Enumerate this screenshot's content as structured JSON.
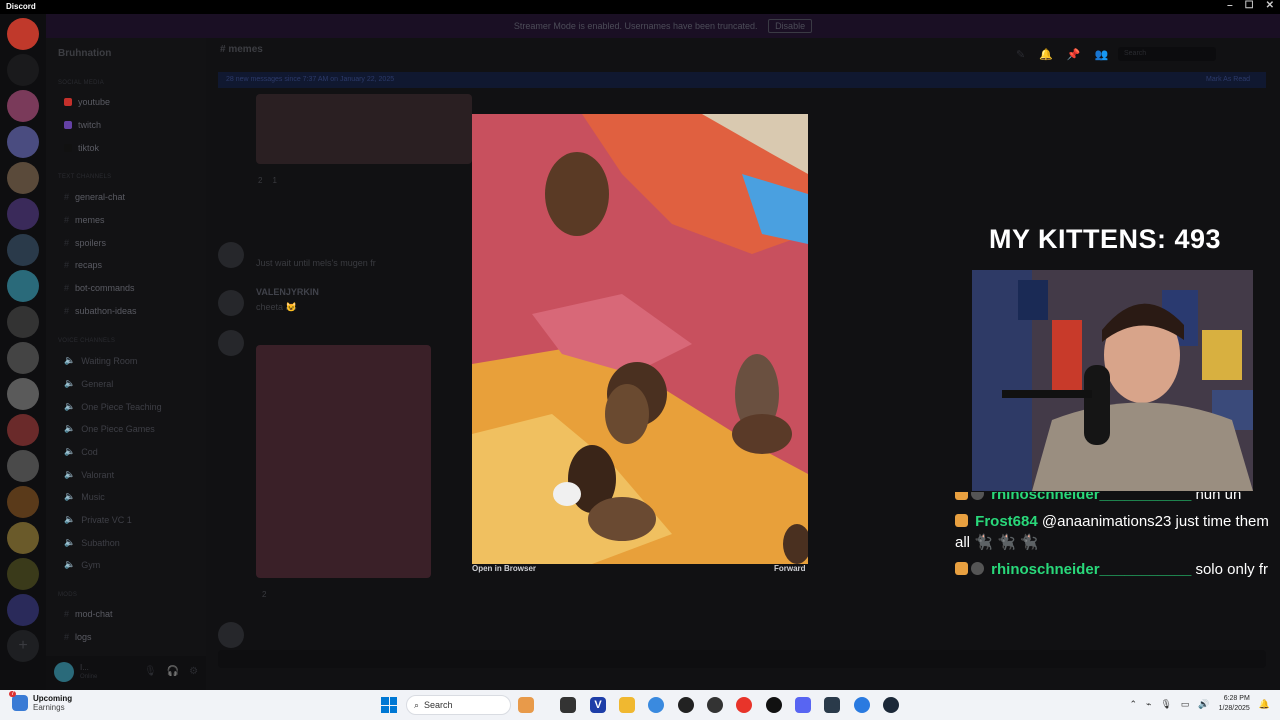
{
  "window": {
    "app_name": "Discord",
    "controls": [
      "–",
      "☐",
      "✕"
    ]
  },
  "streamer_banner": {
    "text": "Streamer Mode is enabled. Usernames have been truncated.",
    "disable_label": "Disable"
  },
  "server": {
    "name": "Bruhnation"
  },
  "sidebar": {
    "sections": [
      {
        "title": "SOCIAL MEDIA",
        "channels": [
          {
            "name": "youtube",
            "color": "#c4302b"
          },
          {
            "name": "twitch",
            "color": "#6441a5"
          },
          {
            "name": "tiktok",
            "color": "#111111"
          }
        ]
      },
      {
        "title": "TEXT CHANNELS",
        "channels": [
          {
            "name": "general-chat"
          },
          {
            "name": "memes"
          },
          {
            "name": "spoilers"
          },
          {
            "name": "recaps"
          },
          {
            "name": "bot-commands"
          },
          {
            "name": "subathon-ideas"
          }
        ]
      },
      {
        "title": "VOICE CHANNELS",
        "channels": [
          {
            "name": "Waiting Room"
          },
          {
            "name": "General"
          },
          {
            "name": "One Piece Teaching"
          },
          {
            "name": "One Piece Games"
          },
          {
            "name": "Cod"
          },
          {
            "name": "Valorant"
          },
          {
            "name": "Music"
          },
          {
            "name": "Private VC 1"
          },
          {
            "name": "Subathon"
          },
          {
            "name": "Gym"
          }
        ]
      },
      {
        "title": "MODS",
        "channels": [
          {
            "name": "mod-chat"
          },
          {
            "name": "logs"
          }
        ]
      }
    ],
    "user": {
      "name": "I...",
      "status": "Online"
    }
  },
  "channel_header": {
    "name": "memes",
    "search_placeholder": "Search"
  },
  "new_messages": {
    "text": "28 new messages since 7:37 AM on January 22, 2025",
    "action": "Mark As Read"
  },
  "messages": [
    {
      "text": "Just wait until mels's mugen fr"
    },
    {
      "author": "VALENJYRKIN",
      "text": "cheeta 😺"
    }
  ],
  "reactions": {
    "first": [
      "2",
      "1"
    ],
    "second": [
      "2"
    ]
  },
  "image_viewer": {
    "open_label": "Open in Browser",
    "forward_label": "Forward"
  },
  "stream_overlay": {
    "counter_label": "MY KITTENS: 493",
    "chat": [
      {
        "user": "rhinoschneider___________",
        "text": "huh uh"
      },
      {
        "user": "Frost684",
        "text": "@anaanimations23 just time them all 🐈‍⬛ 🐈‍⬛ 🐈‍⬛"
      },
      {
        "user": "rhinoschneider___________",
        "text": "solo only fr"
      }
    ]
  },
  "taskbar": {
    "weather_title": "Upcoming",
    "weather_sub": "Earnings",
    "weather_badge": "7",
    "search_label": "Search",
    "time": "6:28 PM",
    "date": "1/28/2025"
  }
}
